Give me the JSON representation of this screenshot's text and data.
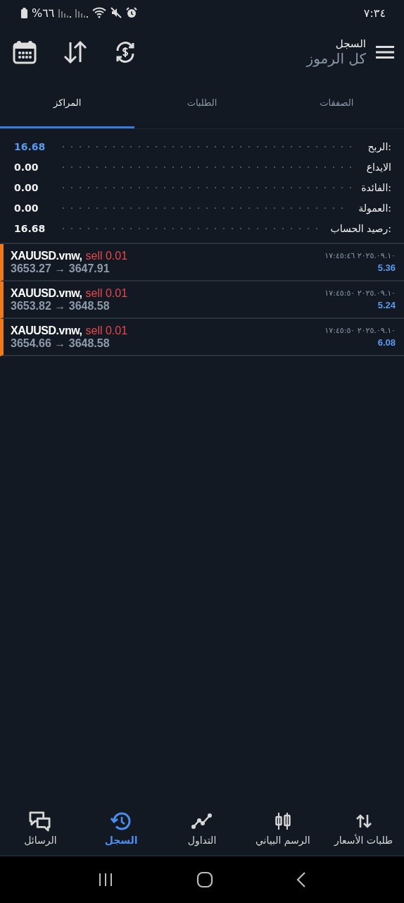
{
  "status_bar": {
    "battery": "%٦٦",
    "time": "٧:٣٤"
  },
  "header": {
    "title": "السجل",
    "subtitle": "كل الرموز"
  },
  "tabs": [
    {
      "label": "الصفقات",
      "selected": false
    },
    {
      "label": "الطلبات",
      "selected": false
    },
    {
      "label": "المراكز",
      "selected": true
    }
  ],
  "summary": [
    {
      "label": "الربح:",
      "value": "16.68",
      "highlight": true
    },
    {
      "label": "الايداع",
      "value": "0.00",
      "highlight": false
    },
    {
      "label": "الفائدة:",
      "value": "0.00",
      "highlight": false
    },
    {
      "label": "العمولة:",
      "value": "0.00",
      "highlight": false
    },
    {
      "label": "رصيد الحساب:",
      "value": "16.68",
      "highlight": false
    }
  ],
  "positions": [
    {
      "symbol": "XAUUSD.vnw,",
      "order": "sell 0.01",
      "prices": "3653.27 → 3647.91",
      "time": "٢٠٢٥.٠٩.١٠ ١٧:٤٥:٤٦",
      "profit": "5.36"
    },
    {
      "symbol": "XAUUSD.vnw,",
      "order": "sell 0.01",
      "prices": "3653.82 → 3648.58",
      "time": "٢٠٢٥.٠٩.١٠ ١٧:٤٥:٥٠",
      "profit": "5.24"
    },
    {
      "symbol": "XAUUSD.vnw,",
      "order": "sell 0.01",
      "prices": "3654.66 → 3648.58",
      "time": "٢٠٢٥.٠٩.١٠ ١٧:٤٥:٥٠",
      "profit": "6.08"
    }
  ],
  "bottom_nav": [
    {
      "label": "طلبات الأسعار",
      "selected": false
    },
    {
      "label": "الرسم البياني",
      "selected": false
    },
    {
      "label": "التداول",
      "selected": false
    },
    {
      "label": "السجل",
      "selected": true
    },
    {
      "label": "الرسائل",
      "selected": false
    }
  ]
}
